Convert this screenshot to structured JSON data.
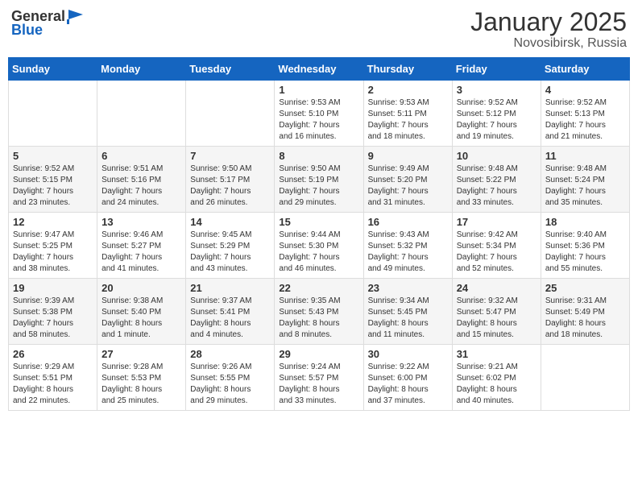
{
  "header": {
    "logo_general": "General",
    "logo_blue": "Blue",
    "month_title": "January 2025",
    "location": "Novosibirsk, Russia"
  },
  "weekdays": [
    "Sunday",
    "Monday",
    "Tuesday",
    "Wednesday",
    "Thursday",
    "Friday",
    "Saturday"
  ],
  "weeks": [
    [
      {
        "day": "",
        "info": ""
      },
      {
        "day": "",
        "info": ""
      },
      {
        "day": "",
        "info": ""
      },
      {
        "day": "1",
        "info": "Sunrise: 9:53 AM\nSunset: 5:10 PM\nDaylight: 7 hours\nand 16 minutes."
      },
      {
        "day": "2",
        "info": "Sunrise: 9:53 AM\nSunset: 5:11 PM\nDaylight: 7 hours\nand 18 minutes."
      },
      {
        "day": "3",
        "info": "Sunrise: 9:52 AM\nSunset: 5:12 PM\nDaylight: 7 hours\nand 19 minutes."
      },
      {
        "day": "4",
        "info": "Sunrise: 9:52 AM\nSunset: 5:13 PM\nDaylight: 7 hours\nand 21 minutes."
      }
    ],
    [
      {
        "day": "5",
        "info": "Sunrise: 9:52 AM\nSunset: 5:15 PM\nDaylight: 7 hours\nand 23 minutes."
      },
      {
        "day": "6",
        "info": "Sunrise: 9:51 AM\nSunset: 5:16 PM\nDaylight: 7 hours\nand 24 minutes."
      },
      {
        "day": "7",
        "info": "Sunrise: 9:50 AM\nSunset: 5:17 PM\nDaylight: 7 hours\nand 26 minutes."
      },
      {
        "day": "8",
        "info": "Sunrise: 9:50 AM\nSunset: 5:19 PM\nDaylight: 7 hours\nand 29 minutes."
      },
      {
        "day": "9",
        "info": "Sunrise: 9:49 AM\nSunset: 5:20 PM\nDaylight: 7 hours\nand 31 minutes."
      },
      {
        "day": "10",
        "info": "Sunrise: 9:48 AM\nSunset: 5:22 PM\nDaylight: 7 hours\nand 33 minutes."
      },
      {
        "day": "11",
        "info": "Sunrise: 9:48 AM\nSunset: 5:24 PM\nDaylight: 7 hours\nand 35 minutes."
      }
    ],
    [
      {
        "day": "12",
        "info": "Sunrise: 9:47 AM\nSunset: 5:25 PM\nDaylight: 7 hours\nand 38 minutes."
      },
      {
        "day": "13",
        "info": "Sunrise: 9:46 AM\nSunset: 5:27 PM\nDaylight: 7 hours\nand 41 minutes."
      },
      {
        "day": "14",
        "info": "Sunrise: 9:45 AM\nSunset: 5:29 PM\nDaylight: 7 hours\nand 43 minutes."
      },
      {
        "day": "15",
        "info": "Sunrise: 9:44 AM\nSunset: 5:30 PM\nDaylight: 7 hours\nand 46 minutes."
      },
      {
        "day": "16",
        "info": "Sunrise: 9:43 AM\nSunset: 5:32 PM\nDaylight: 7 hours\nand 49 minutes."
      },
      {
        "day": "17",
        "info": "Sunrise: 9:42 AM\nSunset: 5:34 PM\nDaylight: 7 hours\nand 52 minutes."
      },
      {
        "day": "18",
        "info": "Sunrise: 9:40 AM\nSunset: 5:36 PM\nDaylight: 7 hours\nand 55 minutes."
      }
    ],
    [
      {
        "day": "19",
        "info": "Sunrise: 9:39 AM\nSunset: 5:38 PM\nDaylight: 7 hours\nand 58 minutes."
      },
      {
        "day": "20",
        "info": "Sunrise: 9:38 AM\nSunset: 5:40 PM\nDaylight: 8 hours\nand 1 minute."
      },
      {
        "day": "21",
        "info": "Sunrise: 9:37 AM\nSunset: 5:41 PM\nDaylight: 8 hours\nand 4 minutes."
      },
      {
        "day": "22",
        "info": "Sunrise: 9:35 AM\nSunset: 5:43 PM\nDaylight: 8 hours\nand 8 minutes."
      },
      {
        "day": "23",
        "info": "Sunrise: 9:34 AM\nSunset: 5:45 PM\nDaylight: 8 hours\nand 11 minutes."
      },
      {
        "day": "24",
        "info": "Sunrise: 9:32 AM\nSunset: 5:47 PM\nDaylight: 8 hours\nand 15 minutes."
      },
      {
        "day": "25",
        "info": "Sunrise: 9:31 AM\nSunset: 5:49 PM\nDaylight: 8 hours\nand 18 minutes."
      }
    ],
    [
      {
        "day": "26",
        "info": "Sunrise: 9:29 AM\nSunset: 5:51 PM\nDaylight: 8 hours\nand 22 minutes."
      },
      {
        "day": "27",
        "info": "Sunrise: 9:28 AM\nSunset: 5:53 PM\nDaylight: 8 hours\nand 25 minutes."
      },
      {
        "day": "28",
        "info": "Sunrise: 9:26 AM\nSunset: 5:55 PM\nDaylight: 8 hours\nand 29 minutes."
      },
      {
        "day": "29",
        "info": "Sunrise: 9:24 AM\nSunset: 5:57 PM\nDaylight: 8 hours\nand 33 minutes."
      },
      {
        "day": "30",
        "info": "Sunrise: 9:22 AM\nSunset: 6:00 PM\nDaylight: 8 hours\nand 37 minutes."
      },
      {
        "day": "31",
        "info": "Sunrise: 9:21 AM\nSunset: 6:02 PM\nDaylight: 8 hours\nand 40 minutes."
      },
      {
        "day": "",
        "info": ""
      }
    ]
  ]
}
